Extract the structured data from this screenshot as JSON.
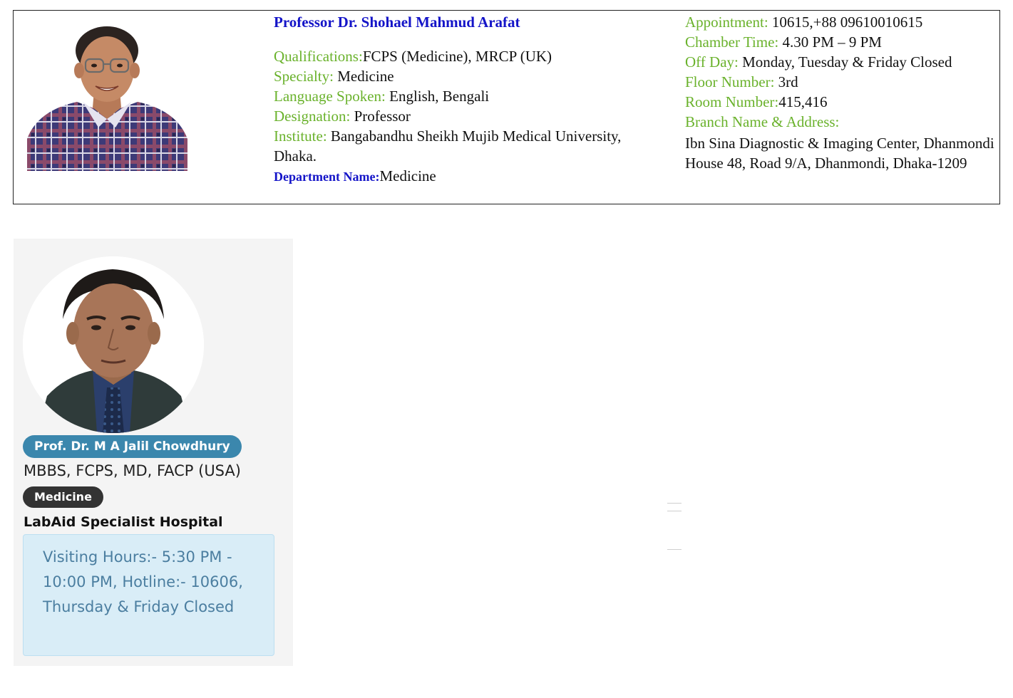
{
  "doctor_1": {
    "name": "Professor Dr. Shohael Mahmud Arafat",
    "qualifications_label": "Qualifications:",
    "qualifications": "FCPS (Medicine), MRCP (UK)",
    "specialty_label": "Specialty:",
    "specialty": "Medicine",
    "language_label": "Language Spoken:",
    "language": "English, Bengali",
    "designation_label": "Designation:",
    "designation": "Professor",
    "institute_label": "Institute:",
    "institute": "Bangabandhu Sheikh Mujib Medical University, Dhaka.",
    "department_label": "Department Name:",
    "department": "Medicine",
    "appointment_label": "Appointment:",
    "appointment": "10615,+88 09610010615",
    "chamber_time_label": "Chamber Time:",
    "chamber_time": "4.30 PM – 9 PM",
    "off_day_label": "Off Day:",
    "off_day": "Monday, Tuesday & Friday Closed",
    "floor_label": "Floor Number:",
    "floor": "3rd",
    "room_label": "Room Number:",
    "room": "415,416",
    "branch_label": "Branch Name & Address:",
    "branch_name": "Ibn Sina Diagnostic & Imaging Center, Dhanmondi",
    "branch_address": "House 48, Road 9/A, Dhanmondi, Dhaka-1209"
  },
  "doctor_2": {
    "name": "Prof. Dr. M A Jalil Chowdhury",
    "qualifications": "MBBS, FCPS, MD, FACP (USA)",
    "specialty": "Medicine",
    "hospital": "LabAid Specialist Hospital",
    "visiting_hours": "Visiting Hours:- 5:30 PM - 10:00 PM, Hotline:- 10606, Thursday & Friday Closed"
  },
  "colors": {
    "name_blue": "#1414c8",
    "label_green": "#6ab22c",
    "badge_blue": "#3b87ad",
    "badge_dark": "#333333",
    "alert_bg": "#d9edf7",
    "alert_text": "#4b7ea0"
  }
}
